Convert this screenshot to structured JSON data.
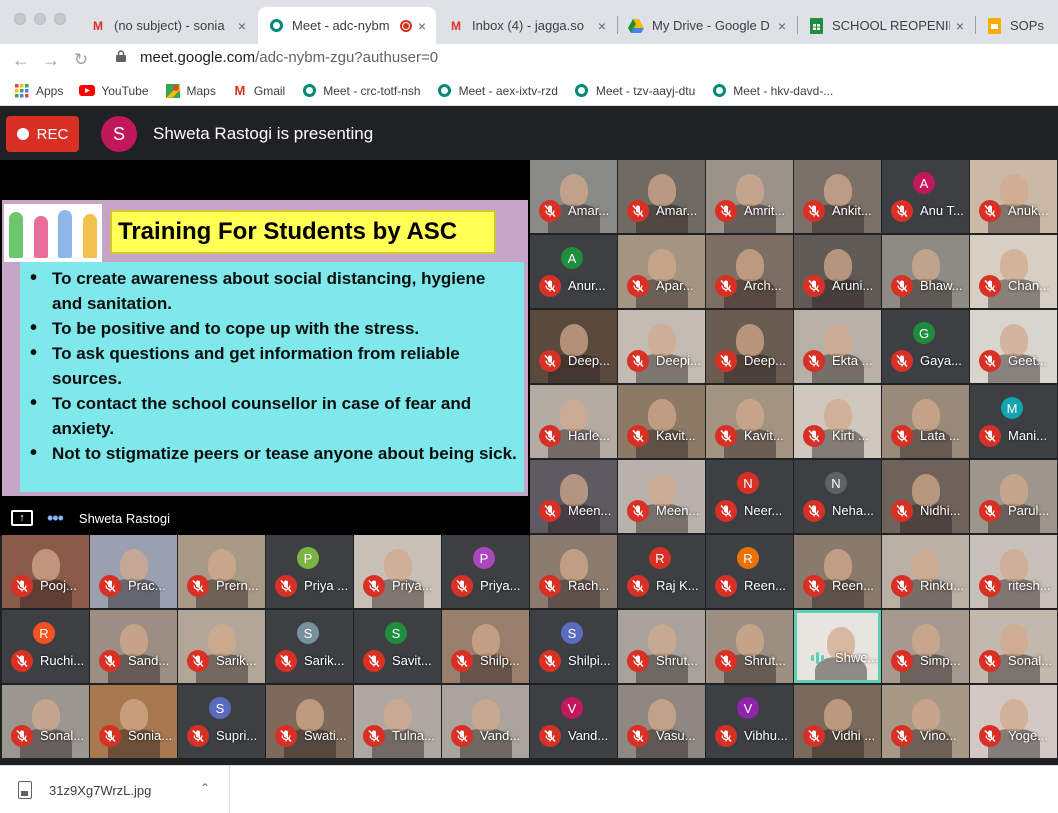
{
  "browser": {
    "tabs": [
      {
        "title": "(no subject) - sonia",
        "icon": "gmail-icon",
        "icon_color": "#d93025"
      },
      {
        "title": "Meet - adc-nybm",
        "icon": "meet-icon",
        "icon_color": "#00897b",
        "active": true
      },
      {
        "title": "Inbox (4) - jagga.so",
        "icon": "gmail-icon",
        "icon_color": "#d93025"
      },
      {
        "title": "My Drive - Google D",
        "icon": "drive-icon",
        "icon_color": "#1e8e3e"
      },
      {
        "title": "SCHOOL REOPENIN",
        "icon": "sheets-icon",
        "icon_color": "#1e8e3e"
      },
      {
        "title": "SOPs OF",
        "icon": "slides-icon",
        "icon_color": "#f9ab00"
      }
    ],
    "url_host": "meet.google.com",
    "url_path": "/adc-nybm-zgu?authuser=0",
    "bookmarks": [
      {
        "label": "Apps",
        "icon": "apps-grid-icon"
      },
      {
        "label": "YouTube",
        "icon": "youtube-icon"
      },
      {
        "label": "Maps",
        "icon": "maps-icon"
      },
      {
        "label": "Gmail",
        "icon": "gmail-icon"
      },
      {
        "label": "Meet - crc-totf-nsh",
        "icon": "meet-icon"
      },
      {
        "label": "Meet - aex-ixtv-rzd",
        "icon": "meet-icon"
      },
      {
        "label": "Meet - tzv-aayj-dtu",
        "icon": "meet-icon"
      },
      {
        "label": "Meet - hkv-davd-...",
        "icon": "meet-icon"
      }
    ]
  },
  "meet": {
    "rec_label": "REC",
    "presenter_initial": "S",
    "presenter_avatar_color": "#c2185b",
    "presenting_text": "Shweta Rastogi is presenting",
    "presenter_name": "Shweta Rastogi",
    "slide": {
      "title": "Training For Students by ASC",
      "bullets": [
        "To create awareness about social distancing, hygiene and sanitation.",
        "To be positive and to cope up with the stress.",
        "To ask questions and get information from reliable sources.",
        "To contact the school counsellor in case of fear and anxiety.",
        "Not to stigmatize peers or tease anyone about being sick."
      ]
    },
    "participants_right": [
      {
        "name": "Amar...",
        "bg": "#8a8a86"
      },
      {
        "name": "Amar...",
        "bg": "#6f6a62"
      },
      {
        "name": "Amrit...",
        "bg": "#9b938a"
      },
      {
        "name": "Ankit...",
        "bg": "#7a7068"
      },
      {
        "name": "Anu T...",
        "bg": "#3c4043",
        "initial": "A",
        "initial_color": "#c2185b"
      },
      {
        "name": "Anuk...",
        "bg": "#c9b9a6"
      },
      {
        "name": "Anur...",
        "bg": "#3c4043",
        "initial": "A",
        "initial_color": "#1e8e3e"
      },
      {
        "name": "Apar...",
        "bg": "#a49583"
      },
      {
        "name": "Arch...",
        "bg": "#7c6e62"
      },
      {
        "name": "Aruni...",
        "bg": "#5f5a56"
      },
      {
        "name": "Bhaw...",
        "bg": "#8e8a84"
      },
      {
        "name": "Chan...",
        "bg": "#d7cfc4"
      },
      {
        "name": "Deep...",
        "bg": "#5a4a3e"
      },
      {
        "name": "Deepi...",
        "bg": "#c4bcb2"
      },
      {
        "name": "Deep...",
        "bg": "#6a5c50"
      },
      {
        "name": "Ekta ...",
        "bg": "#b7b0a6"
      },
      {
        "name": "Gaya...",
        "bg": "#3c4043",
        "initial": "G",
        "initial_color": "#1e8e3e"
      },
      {
        "name": "Geet...",
        "bg": "#d8d4ce"
      },
      {
        "name": "Harle...",
        "bg": "#b4aca2"
      },
      {
        "name": "Kavit...",
        "bg": "#8d7a66"
      },
      {
        "name": "Kavit...",
        "bg": "#a39482"
      },
      {
        "name": "Kirti ...",
        "bg": "#cfc8be"
      },
      {
        "name": "Lata ...",
        "bg": "#9a8a7a"
      },
      {
        "name": "Mani...",
        "bg": "#3c4043",
        "initial": "M",
        "initial_color": "#12a4af"
      },
      {
        "name": "Meen...",
        "bg": "#5d5a62"
      },
      {
        "name": "Meen...",
        "bg": "#b8b2aa"
      },
      {
        "name": "Neer...",
        "bg": "#3c4043",
        "initial": "N",
        "initial_color": "#d93025"
      },
      {
        "name": "Neha...",
        "bg": "#3c4043",
        "initial": "N",
        "initial_color": "#5f6368"
      },
      {
        "name": "Nidhi...",
        "bg": "#6e625a"
      },
      {
        "name": "Parul...",
        "bg": "#9e968c"
      },
      {
        "name": "Rach...",
        "bg": "#8c7c70"
      },
      {
        "name": "Raj K...",
        "bg": "#3c4043",
        "initial": "R",
        "initial_color": "#d93025"
      },
      {
        "name": "Reen...",
        "bg": "#3c4043",
        "initial": "R",
        "initial_color": "#e8710a"
      },
      {
        "name": "Reen...",
        "bg": "#8a7a6c"
      },
      {
        "name": "Rinku...",
        "bg": "#b9afa4"
      },
      {
        "name": "ritesh...",
        "bg": "#c6c0b8"
      },
      {
        "name": "Shilpi...",
        "bg": "#3c4043",
        "initial": "S",
        "initial_color": "#5c6bc0"
      },
      {
        "name": "Shrut...",
        "bg": "#a8a29a"
      },
      {
        "name": "Shrut...",
        "bg": "#9c8e80"
      },
      {
        "name": "Shwe...",
        "bg": "#e8e4df",
        "active": true
      },
      {
        "name": "Simp...",
        "bg": "#a69a8e"
      },
      {
        "name": "Sonal...",
        "bg": "#c2b8ac"
      },
      {
        "name": "Vand...",
        "bg": "#3c4043",
        "initial": "V",
        "initial_color": "#c2185b"
      },
      {
        "name": "Vasu...",
        "bg": "#8e8880"
      },
      {
        "name": "Vibhu...",
        "bg": "#3c4043",
        "initial": "V",
        "initial_color": "#8e24aa"
      },
      {
        "name": "Vidhi ...",
        "bg": "#7a6a5c"
      },
      {
        "name": "Vino...",
        "bg": "#a89886"
      },
      {
        "name": "Yoge...",
        "bg": "#d4c8c4"
      }
    ],
    "participants_left": [
      {
        "name": "Pooj...",
        "bg": "#8a5a4a"
      },
      {
        "name": "Prac...",
        "bg": "#9aa0b0"
      },
      {
        "name": "Prern...",
        "bg": "#a89a86"
      },
      {
        "name": "Priya ...",
        "bg": "#3c4043",
        "initial": "P",
        "initial_color": "#7cb342"
      },
      {
        "name": "Priya...",
        "bg": "#c8c0b6"
      },
      {
        "name": "Priya...",
        "bg": "#3c4043",
        "initial": "P",
        "initial_color": "#ab47bc"
      },
      {
        "name": "Ruchi...",
        "bg": "#3c4043",
        "initial": "R",
        "initial_color": "#f4511e"
      },
      {
        "name": "Sand...",
        "bg": "#9c8e82"
      },
      {
        "name": "Sarik...",
        "bg": "#b2a698"
      },
      {
        "name": "Sarik...",
        "bg": "#3c4043",
        "initial": "S",
        "initial_color": "#78909c"
      },
      {
        "name": "Savit...",
        "bg": "#3c4043",
        "initial": "S",
        "initial_color": "#1e8e3e"
      },
      {
        "name": "Shilp...",
        "bg": "#9a7e6c"
      },
      {
        "name": "Sonal...",
        "bg": "#9c9690"
      },
      {
        "name": "Sonia...",
        "bg": "#a8784e"
      },
      {
        "name": "Supri...",
        "bg": "#3c4043",
        "initial": "S",
        "initial_color": "#5c6bc0"
      },
      {
        "name": "Swati...",
        "bg": "#7e6a5a"
      },
      {
        "name": "Tulna...",
        "bg": "#b0a8a0"
      },
      {
        "name": "Vand...",
        "bg": "#aaa49c"
      }
    ]
  },
  "download": {
    "filename": "31z9Xg7WrzL.jpg"
  }
}
